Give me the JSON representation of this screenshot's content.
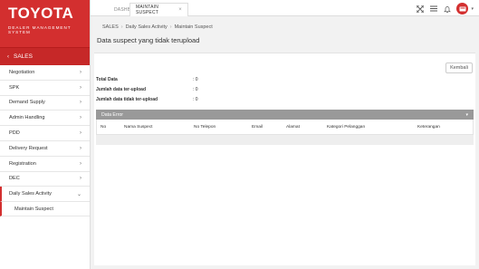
{
  "brand": {
    "logo": "TOYOTA",
    "subtitle": "DEALER MANAGEMENT SYSTEM"
  },
  "sidebar": {
    "section_label": "SALES",
    "items": [
      {
        "label": "Negotiation"
      },
      {
        "label": "SPK"
      },
      {
        "label": "Demand Supply"
      },
      {
        "label": "Admin Handling"
      },
      {
        "label": "PDD"
      },
      {
        "label": "Delivery Request"
      },
      {
        "label": "Registration"
      },
      {
        "label": "DEC"
      },
      {
        "label": "Daily Sales Activity"
      }
    ],
    "subitem": "Maintain Suspect"
  },
  "tabs": {
    "tab1": "DASHBOARD",
    "tab2": "MAINTAIN SUSPECT",
    "close": "×"
  },
  "breadcrumb": {
    "root": "SALES",
    "parent": "Daily Sales Activity",
    "current": "Maintain Suspect"
  },
  "page": {
    "title": "Data suspect yang tidak terupload",
    "back_button": "Kembali"
  },
  "summary": [
    {
      "label": "Total Data",
      "value": ": 0"
    },
    {
      "label": "Jumlah data ter-upload",
      "value": ": 0"
    },
    {
      "label": "Jumlah data tidak ter-upload",
      "value": ": 0"
    }
  ],
  "error_section": {
    "title": "Data Error",
    "columns": [
      "No",
      "Nama Suspect",
      "No Telepon",
      "Email",
      "Alamat",
      "Kategori Pelanggan",
      "Keterangan"
    ]
  },
  "colors": {
    "brand_red": "#d32f2f",
    "header_gray": "#999999"
  },
  "icons": [
    "expand-icon",
    "list-icon",
    "bell-icon",
    "user-avatar-icon"
  ]
}
